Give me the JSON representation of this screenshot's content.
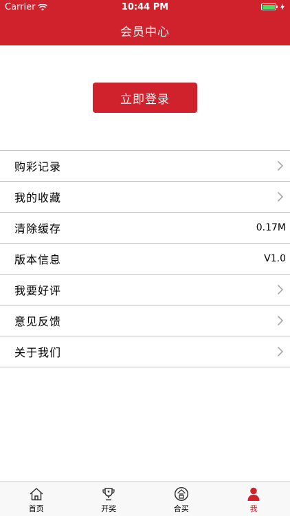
{
  "status_bar": {
    "carrier": "Carrier",
    "time": "10:44 PM"
  },
  "header": {
    "title": "会员中心"
  },
  "login_button": {
    "label": "立即登录"
  },
  "menu": {
    "items": [
      {
        "label": "购彩记录"
      },
      {
        "label": "我的收藏"
      },
      {
        "label": "清除缓存",
        "value": "0.17M"
      },
      {
        "label": "版本信息",
        "value": "V1.0"
      },
      {
        "label": "我要好评"
      },
      {
        "label": "意见反馈"
      },
      {
        "label": "关于我们"
      }
    ]
  },
  "tabbar": {
    "tabs": [
      {
        "label": "首页",
        "icon": "home-icon"
      },
      {
        "label": "开奖",
        "icon": "trophy-icon"
      },
      {
        "label": "合买",
        "icon": "group-buy-icon"
      },
      {
        "label": "我",
        "icon": "user-icon",
        "active": true
      }
    ]
  },
  "colors": {
    "brand_red": "#d0222d",
    "battery_green": "#4cd964",
    "divider": "#bdbdbd"
  }
}
